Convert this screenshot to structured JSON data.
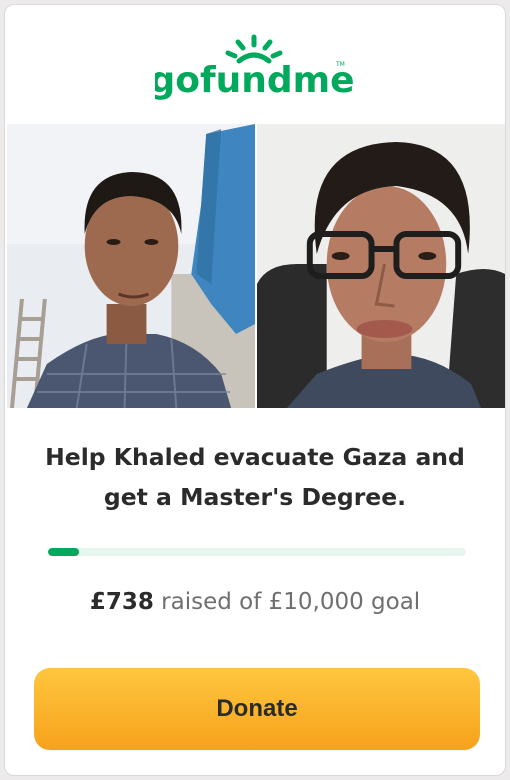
{
  "brand": {
    "logo_text": "gofundme",
    "trademark": "TM",
    "color": "#02a95c"
  },
  "campaign": {
    "title": "Help Khaled evacuate Gaza and get a Master's Degree.",
    "raised_amount": "£738",
    "raised_suffix": "raised of £10,000 goal",
    "progress_fraction": 0.0738
  },
  "donate": {
    "label": "Donate",
    "color_top": "#ffc63f",
    "color_bottom": "#f7a21b"
  },
  "icons": {
    "logo": "gofundme-sun-logo"
  }
}
